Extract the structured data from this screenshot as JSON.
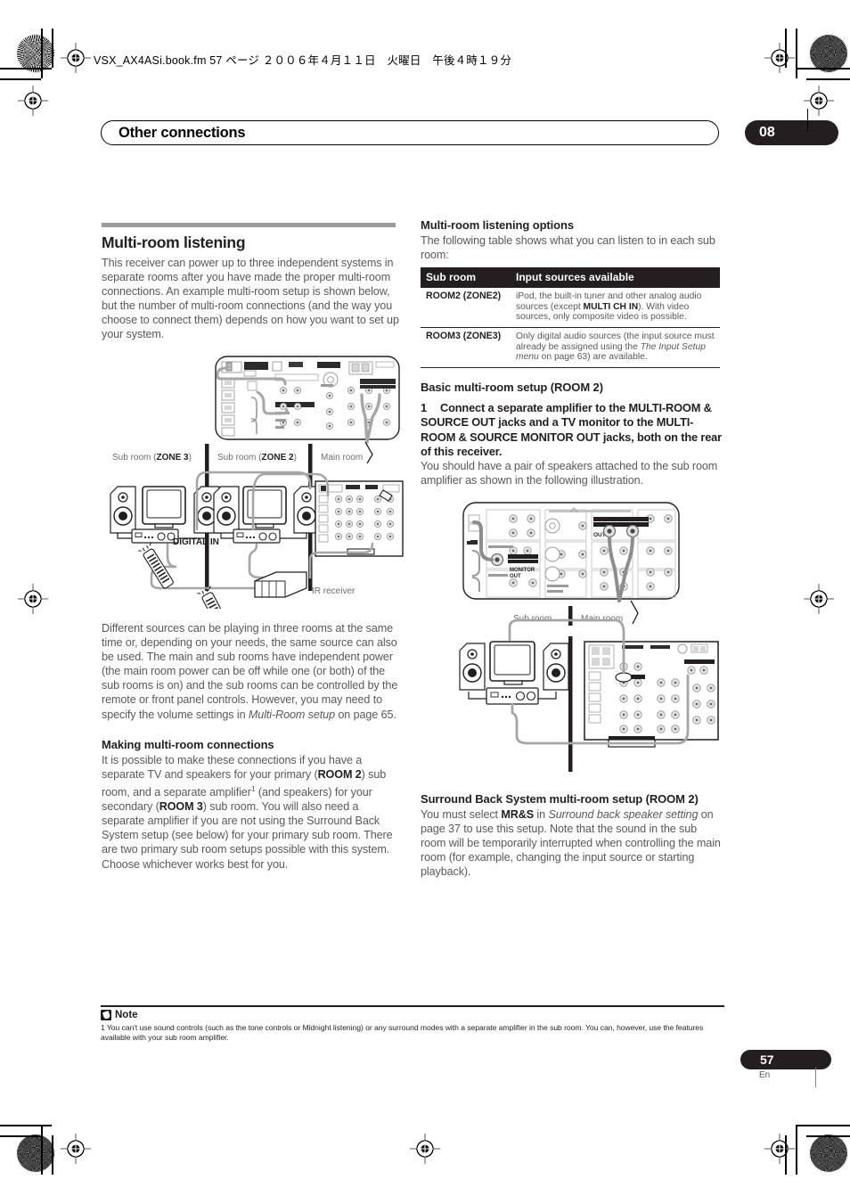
{
  "print_marks": {
    "filename_line": "VSX_AX4ASi.book.fm  57 ページ  ２００６年４月１１日　火曜日　午後４時１９分"
  },
  "header": {
    "chapter_title": "Other connections",
    "chapter_number": "08"
  },
  "left_column": {
    "section_title": "Multi-room listening",
    "intro": "This receiver can power up to three independent systems in separate rooms after you have made the proper multi-room connections. An example multi-room setup is shown below, but the number of multi-room connections (and the way you choose to connect them) depends on how you want to set up your system.",
    "diagram_labels": {
      "zone3": "Sub room (",
      "zone3_bold": "ZONE 3",
      "zone3_end": ")",
      "zone2": "Sub room (",
      "zone2_bold": "ZONE 2",
      "zone2_end": ")",
      "main_room": "Main room",
      "digital_in": "DIGITAL IN",
      "ir_receiver": "IR receiver"
    },
    "after_diagram": "Different sources can be playing in three rooms at the same time or, depending on your needs, the same source can also be used. The main and sub rooms have independent power (the main room power can be off while one (or both) of the sub rooms is on) and the sub rooms can be controlled by the remote or front panel controls. However, you may need to specify the volume settings in Multi-Room setup on page 65.",
    "after_diagram_italic": "Multi-Room setup",
    "making_heading": "Making multi-room connections",
    "making_p1_a": "It is possible to make these connections if you have a separate TV and speakers for your primary (",
    "making_p1_room2": "ROOM 2",
    "making_p1_b": ") sub room, and a separate amplifier",
    "making_p1_fn": "1",
    "making_p1_c": " (and speakers) for your secondary (",
    "making_p1_room3": "ROOM 3",
    "making_p1_d": ") sub room. You will also need a separate amplifier if you are not using the Surround Back System setup (see below) for your primary sub room. There are two primary sub room setups possible with this system. Choose whichever works best for you."
  },
  "right_column": {
    "options_heading": "Multi-room listening options",
    "options_intro": "The following table shows what you can listen to in each sub room:",
    "table": {
      "headers": [
        "Sub room",
        "Input sources available"
      ],
      "rows": [
        {
          "room": "ROOM2 (ZONE2)",
          "sources_a": "iPod, the built-in tuner and other analog audio sources (except ",
          "sources_bold": "MULTI CH IN",
          "sources_b": "). With video sources, only composite video is possible."
        },
        {
          "room": "ROOM3 (ZONE3)",
          "sources_a": "Only digital audio sources (the input source must already be assigned using the ",
          "sources_italic": "The Input Setup menu",
          "sources_b": " on page 63) are available."
        }
      ]
    },
    "basic_heading": "Basic multi-room setup (ROOM 2)",
    "step_number": "1",
    "step_text": "Connect a separate amplifier to the MULTI-ROOM & SOURCE OUT jacks and a TV monitor to the MULTI-ROOM & SOURCE MONITOR OUT jacks, both on the rear of this receiver.",
    "step_follow": "You should have a pair of speakers attached to the sub room amplifier as shown in the following illustration.",
    "diagram_labels": {
      "sub_room": "Sub room",
      "main_room": "Main room",
      "out": "OUT",
      "monitor_out": "MONITOR OUT",
      "multi_room_source": "MULTI-ROOM & SOURCE"
    },
    "surround_heading": "Surround Back System multi-room setup (ROOM 2)",
    "surround_a": "You must select ",
    "surround_bold": "MR&S",
    "surround_b": " in ",
    "surround_italic": "Surround back speaker setting",
    "surround_c": " on page 37 to use this setup. Note that the sound in the sub room will be temporarily interrupted when controlling the main room (for example, changing the input source or starting playback)."
  },
  "footnote": {
    "label": "Note",
    "text": "1 You can't use sound controls (such as the tone controls or Midnight listening) or any surround modes with a separate amplifier in the sub room. You can, however, use the features available with your sub room amplifier."
  },
  "footer": {
    "page_number": "57",
    "language": "En"
  },
  "colors": {
    "ink": "#231f20",
    "body_gray": "#58595b",
    "rule_gray": "#9a9a9a"
  }
}
